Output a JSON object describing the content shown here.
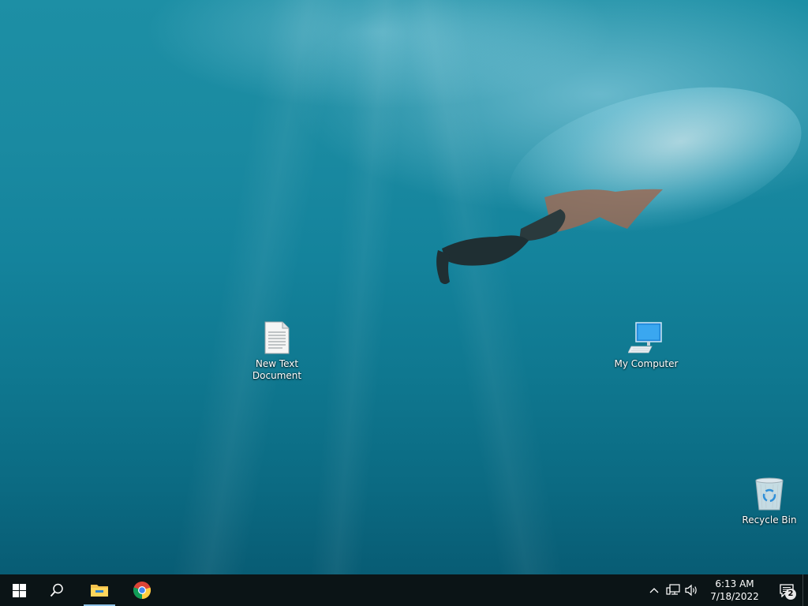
{
  "desktop": {
    "icons": [
      {
        "label": "New Text Document",
        "icon": "text-document-icon"
      },
      {
        "label": "My Computer",
        "icon": "computer-monitor-icon"
      },
      {
        "label": "Recycle Bin",
        "icon": "recycle-bin-icon"
      }
    ]
  },
  "taskbar": {
    "start_icon": "windows-logo-icon",
    "search_icon": "search-icon",
    "apps": [
      {
        "name": "File Explorer",
        "icon": "folder-icon",
        "active": true
      },
      {
        "name": "Google Chrome",
        "icon": "chrome-icon",
        "active": false
      }
    ],
    "tray": {
      "chevron_icon": "chevron-up-icon",
      "network_icon": "network-icon",
      "volume_icon": "volume-icon",
      "time": "6:13 AM",
      "date": "7/18/2022",
      "notification_icon": "action-center-icon",
      "notification_count": "2"
    }
  },
  "colors": {
    "taskbar_bg": "#0b1416",
    "active_indicator": "#8fc3e8",
    "wallpaper_top": "#1d8fa5",
    "wallpaper_bottom": "#085c74"
  }
}
